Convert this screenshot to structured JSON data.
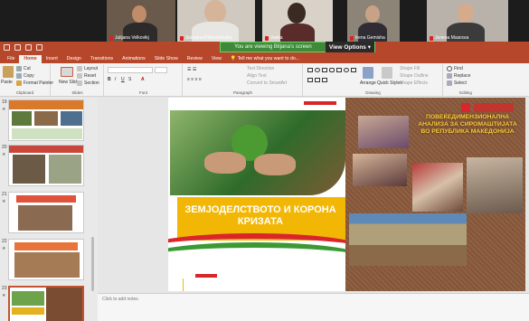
{
  "participants": [
    {
      "name": "Julijana Velkovikj",
      "muted": true
    },
    {
      "name": "Snezana Petrushevska",
      "muted": true
    },
    {
      "name": "Vaska",
      "muted": true
    },
    {
      "name": "Irena Gemisha",
      "muted": true
    },
    {
      "name": "Јелена Мазоска",
      "muted": true
    }
  ],
  "share": {
    "message": "You are viewing Biljana's screen",
    "view_options": "View Options"
  },
  "tabs": [
    "File",
    "Home",
    "Insert",
    "Design",
    "Transitions",
    "Animations",
    "Slide Show",
    "Review",
    "View"
  ],
  "active_tab": "Home",
  "tell_me": "Tell me what you want to do...",
  "ribbon": {
    "clipboard": {
      "paste": "Paste",
      "cut": "Cut",
      "copy": "Copy",
      "format_painter": "Format Painter",
      "label": "Clipboard"
    },
    "slides": {
      "new_slide": "New Slide",
      "layout": "Layout",
      "reset": "Reset",
      "section": "Section",
      "label": "Slides"
    },
    "font": {
      "label": "Font"
    },
    "paragraph": {
      "text_direction": "Text Direction",
      "align_text": "Align Text",
      "convert_smartart": "Convert to SmartArt",
      "label": "Paragraph"
    },
    "drawing": {
      "arrange": "Arrange",
      "quick_styles": "Quick Styles",
      "shape_fill": "Shape Fill",
      "shape_outline": "Shape Outline",
      "shape_effects": "Shape Effects",
      "label": "Drawing"
    },
    "editing": {
      "find": "Find",
      "replace": "Replace",
      "select": "Select",
      "label": "Editing"
    }
  },
  "thumbnails": [
    {
      "number": "19"
    },
    {
      "number": "20"
    },
    {
      "number": "21"
    },
    {
      "number": "22"
    },
    {
      "number": "23"
    }
  ],
  "slide": {
    "left_title": "ЗЕМЈОДЕЛСТВОТО И КОРОНА КРИЗАТА",
    "right_title": "ПОВЕЌЕДИМЕНЗИОНАЛНА АНАЛИЗА ЗА СИРОМАШТИЈАТА ВО РЕПУБЛИКА МАКЕДОНИЈА",
    "accent_red": "#d8262a",
    "accent_yellow": "#f2b705",
    "accent_green": "#3c9a35"
  },
  "notes_placeholder": "Click to add notes",
  "colors": {
    "ppt_red": "#b7472a",
    "share_green": "#3e8a3a"
  }
}
